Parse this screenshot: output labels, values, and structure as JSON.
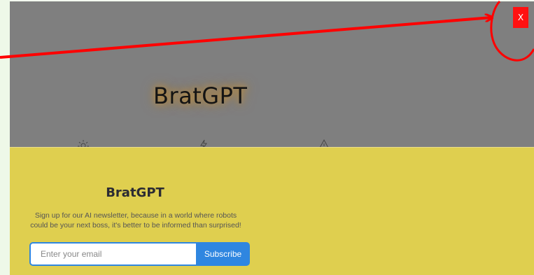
{
  "hero": {
    "title": "BratGPT"
  },
  "features": {
    "icons": [
      "sun-icon",
      "bolt-icon",
      "warning-icon"
    ]
  },
  "close_button": {
    "label": "X",
    "color": "#ff1111"
  },
  "newsletter_modal": {
    "title": "BratGPT",
    "description": "Sign up for our AI newsletter, because in a world where robots could be your next boss, it's better to be informed than surprised!",
    "email_placeholder": "Enter your email",
    "email_value": "",
    "subscribe_label": "Subscribe",
    "background_color": "#dfcf4f",
    "accent_color": "#2f86e0"
  },
  "annotation": {
    "color": "#ff0000",
    "shapes": [
      "arrow",
      "circle"
    ]
  }
}
